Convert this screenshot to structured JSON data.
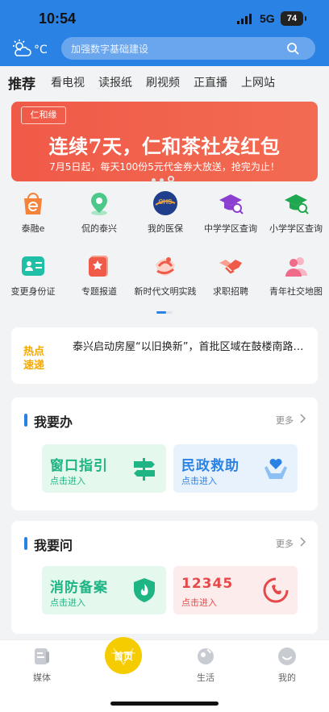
{
  "status_bar": {
    "time": "10:54",
    "network": "5G",
    "battery": "74"
  },
  "header": {
    "weather_unit": "°C",
    "search_placeholder": "加强数字基础建设"
  },
  "tabs": [
    {
      "label": "推荐",
      "active": true
    },
    {
      "label": "看电视"
    },
    {
      "label": "读报纸"
    },
    {
      "label": "刷视频"
    },
    {
      "label": "正直播"
    },
    {
      "label": "上网站"
    }
  ],
  "banner": {
    "logo_text": "仁和缘",
    "headline": "连续7天，仁和茶社发红包",
    "subtitle": "7月5日起，每天100份5元代金券大放送，抢完为止！"
  },
  "grid": [
    {
      "label": "泰融e",
      "icon": "bag-e-icon",
      "color": "#f5833a"
    },
    {
      "label": "侃的泰兴",
      "icon": "location-pin-icon",
      "color": "#4cc98a"
    },
    {
      "label": "我的医保",
      "icon": "chs-medical-insurance-icon",
      "color": "#1f3e8c"
    },
    {
      "label": "中学学区查询",
      "icon": "graduation-cap-search-icon",
      "color": "#8a3fd1"
    },
    {
      "label": "小学学区查询",
      "icon": "graduation-cap-search-icon",
      "color": "#1fa84f"
    },
    {
      "label": "变更身份证",
      "icon": "id-card-icon",
      "color": "#1fc0a6"
    },
    {
      "label": "专题报道",
      "icon": "star-bookmark-icon",
      "color": "#f05a48"
    },
    {
      "label": "新时代文明实践",
      "icon": "civilization-practice-icon",
      "color": "#f05a48"
    },
    {
      "label": "求职招聘",
      "icon": "handshake-icon",
      "color": "#f05a48"
    },
    {
      "label": "青年社交地图",
      "icon": "people-icon",
      "color": "#f06a8a"
    }
  ],
  "news": {
    "tag_line1": "热点",
    "tag_line2": "速递",
    "text": "泰兴启动房屋“以旧换新”，首批区域在鼓楼南路…"
  },
  "section_do": {
    "title": "我要办",
    "more": "更多",
    "cards": [
      {
        "title": "窗口指引",
        "sub": "点击进入",
        "icon": "signpost-icon"
      },
      {
        "title": "民政救助",
        "sub": "点击进入",
        "icon": "heart-hands-icon"
      }
    ]
  },
  "section_ask": {
    "title": "我要问",
    "more": "更多",
    "cards": [
      {
        "title": "消防备案",
        "sub": "点击进入",
        "icon": "fire-shield-icon"
      },
      {
        "title": "12345",
        "sub": "点击进入",
        "icon": "hotline-12345-icon"
      }
    ]
  },
  "bottom_nav": [
    {
      "label": "媒体",
      "icon": "media-icon"
    },
    {
      "label": "首页",
      "icon": "home-icon",
      "active": true
    },
    {
      "label": "生活",
      "icon": "life-icon"
    },
    {
      "label": "我的",
      "icon": "profile-icon"
    }
  ],
  "colors": {
    "brand_blue": "#2a82e4",
    "banner_red": "#f05a48",
    "home_yellow": "#f5cc00"
  }
}
